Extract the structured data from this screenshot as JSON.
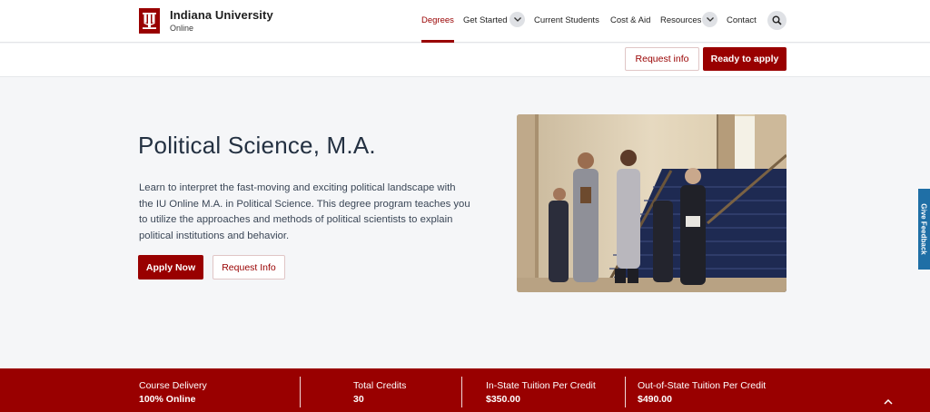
{
  "brand": {
    "name": "Indiana University",
    "sub": "Online"
  },
  "nav": {
    "degrees": "Degrees",
    "get_started": "Get Started",
    "current_students": "Current Students",
    "cost_aid": "Cost & Aid",
    "resources": "Resources",
    "contact": "Contact"
  },
  "cta": {
    "request_info": "Request info",
    "ready_to_apply": "Ready to apply"
  },
  "hero": {
    "title": "Political Science, M.A.",
    "description": "Learn to interpret the fast-moving and exciting political landscape with the IU Online M.A. in Political Science. This degree program teaches you to utilize the approaches and methods of political scientists to explain political institutions and behavior.",
    "apply_now": "Apply Now",
    "request_info": "Request Info"
  },
  "feedback": "Give Feedback",
  "stats": [
    {
      "label": "Course Delivery",
      "value": "100% Online"
    },
    {
      "label": "Total Credits",
      "value": "30"
    },
    {
      "label": "In-State Tuition Per Credit",
      "value": "$350.00"
    },
    {
      "label": "Out-of-State Tuition Per Credit",
      "value": "$490.00"
    }
  ],
  "colors": {
    "brand_crimson": "#990000",
    "feedback_blue": "#1f6fa6",
    "page_bg": "#f5f6f8"
  },
  "icons": [
    "trident-logo-icon",
    "chevron-down-icon",
    "search-icon",
    "chevron-up-icon"
  ]
}
